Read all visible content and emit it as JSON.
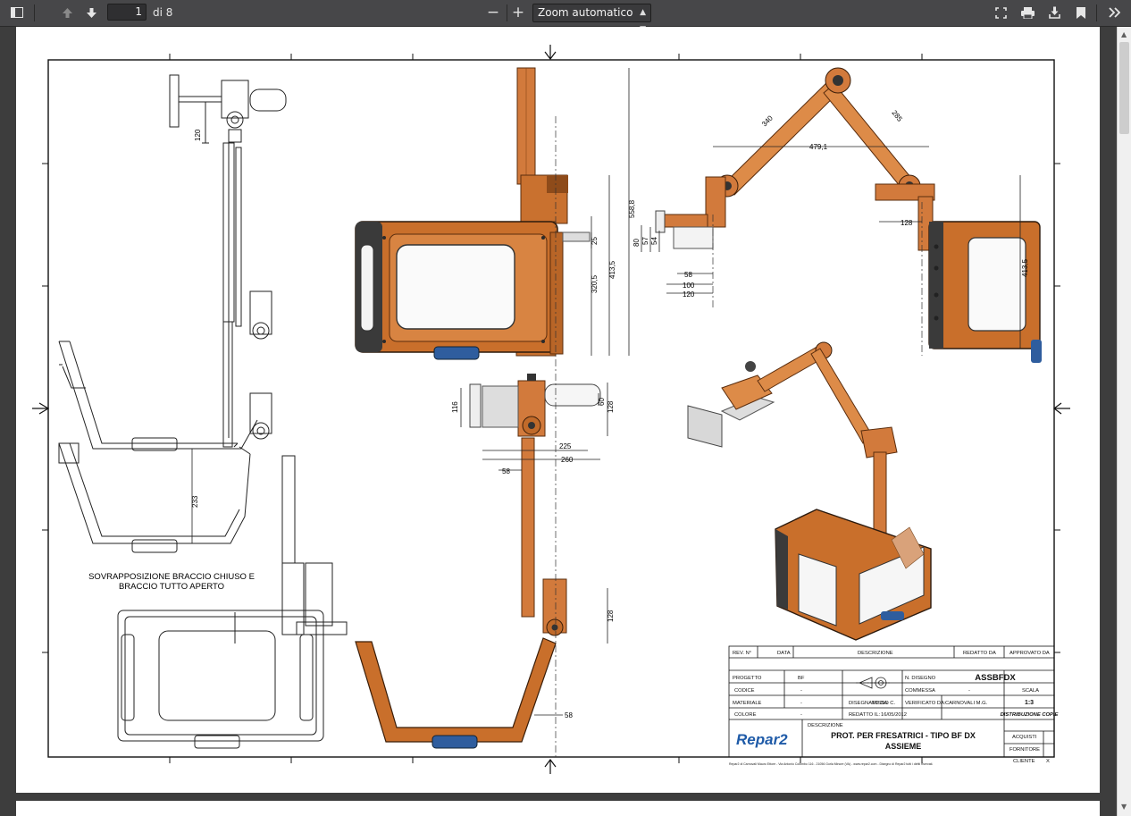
{
  "toolbar": {
    "sidebar_toggle_icon": "sidebar-toggle-icon",
    "page_number": "1",
    "page_count_label": "di 8",
    "zoom_out_label": "−",
    "zoom_in_label": "+",
    "zoom_value": "Zoom automatico"
  },
  "drawing": {
    "caption_line1": "SOVRAPPOSIZIONE BRACCIO CHIUSO E",
    "caption_line2": "BRACCIO TUTTO APERTO",
    "dims": {
      "d120a": "120",
      "d233": "233",
      "d558_8": "558,8",
      "d413_5": "413,5",
      "d320_5": "320,5",
      "d25": "25",
      "d116": "116",
      "d60": "60",
      "d128a": "128",
      "d225": "225",
      "d260": "260",
      "d58a": "58",
      "d128b": "128",
      "d58b": "58",
      "d340": "340",
      "d285": "285",
      "d479_1": "479,1",
      "d128c": "128",
      "d413_5b": "413,5",
      "d80": "80",
      "d57": "57",
      "d54": "54",
      "d58c": "58",
      "d100": "100",
      "d120b": "120"
    }
  },
  "title_block": {
    "rev_label": "REV. N°",
    "data_label": "DATA",
    "descrizione_label": "DESCRIZIONE",
    "redatto_da_label": "REDATTO DA",
    "approvato_da_label": "APPROVATO DA",
    "progetto_label": "PROGETTO",
    "progetto_value": "BF",
    "codice_label": "CODICE",
    "codice_value": "-",
    "materiale_label": "MATERIALE",
    "materiale_value": "-",
    "colore_label": "COLORE",
    "colore_value": "-",
    "n_disegno_label": "N. DISEGNO",
    "n_disegno_value": "ASSBFDX",
    "commessa_label": "COMMESSA",
    "commessa_value": "-",
    "scala_label": "SCALA",
    "scala_value": "1:3",
    "disegnato_da_label": "DISEGNATO DA:",
    "disegnato_da_value": "MISSO C.",
    "verificato_da_label": "VERIFICATO DA:",
    "verificato_da_value": "CARNOVALI M.G.",
    "redatto_il_label": "REDATTO IL:",
    "redatto_il_value": "16/05/2012",
    "distribuzione_label": "DISTRIBUZIONE COPIE",
    "acquisti_label": "ACQUISTI",
    "fornitore_label": "FORNITORE",
    "cliente_label": "CLIENTE",
    "cliente_mark": "X",
    "descrizione_label2": "DESCRIZIONE",
    "title_line1": "PROT. PER FRESATRICI - TIPO BF DX",
    "title_line2": "ASSIEME",
    "logo_text": "Repar2",
    "footer": "Repar2 di Carnovali Mauro Ettore - Via Antonio Colombo 116 - 21056 Gorla Minore (VA) - www.repar2.com - Disegno di Repar2 tutti i diritti riservati."
  },
  "colors": {
    "toolbar_bg": "#474749",
    "viewer_bg": "#3d3d3d",
    "part_orange": "#d27a3c",
    "part_dark": "#2f2f2f",
    "handle_blue": "#2f5d9e",
    "logo_blue": "#1f5ba8"
  }
}
